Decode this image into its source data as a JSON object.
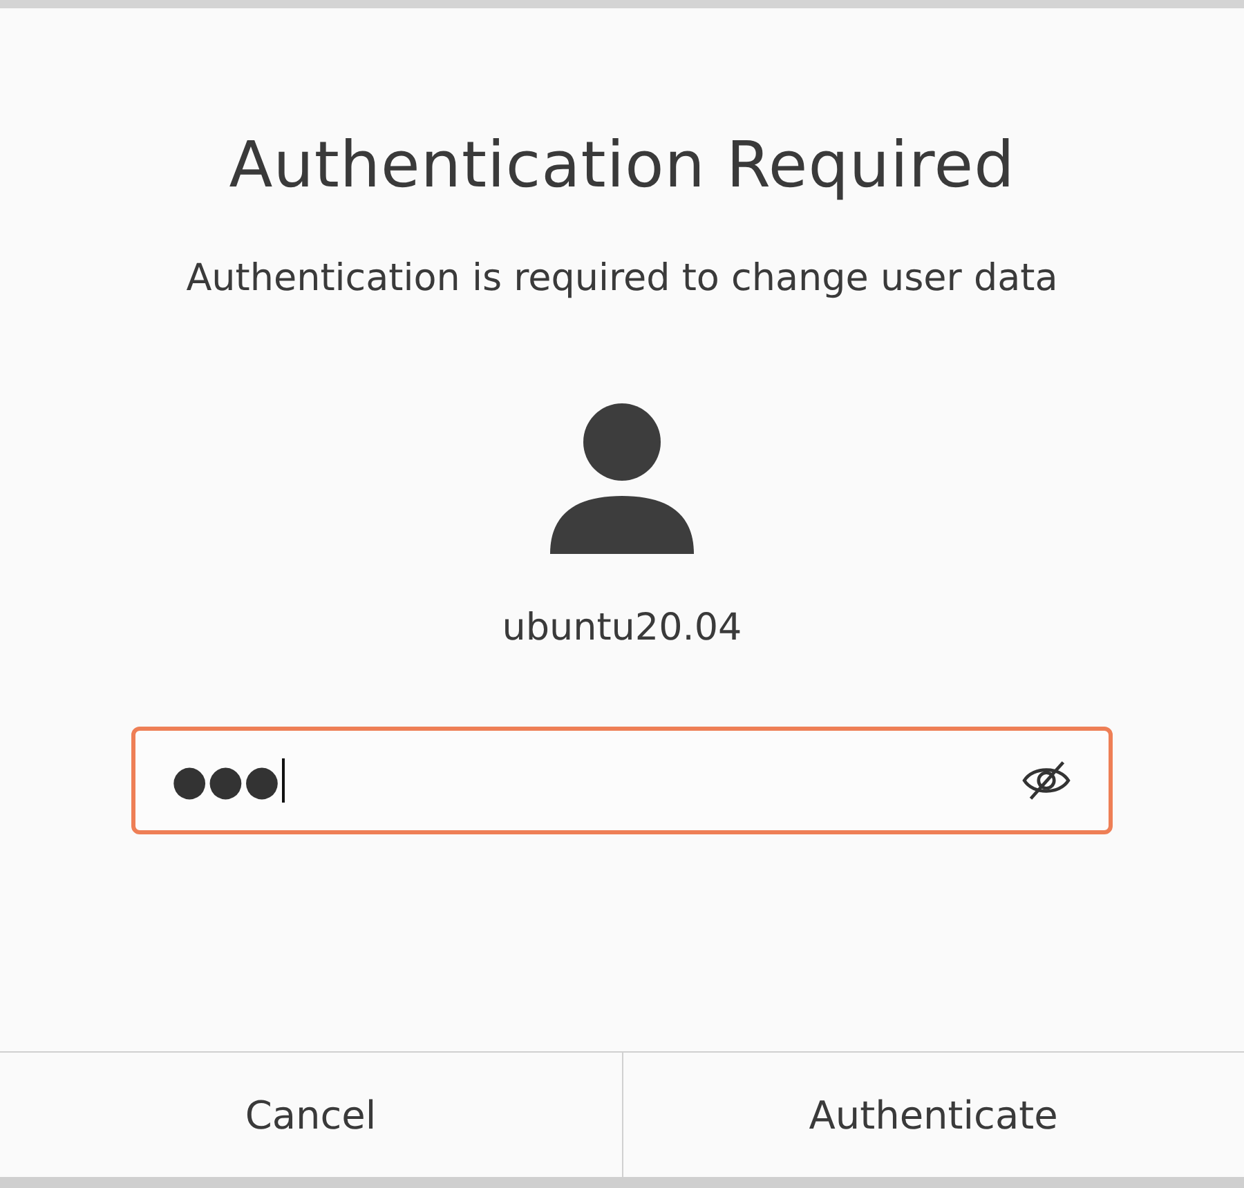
{
  "dialog": {
    "title": "Authentication Required",
    "message": "Authentication is required to change user data"
  },
  "user": {
    "name": "ubuntu20.04"
  },
  "password": {
    "value": "●●●",
    "focused": true
  },
  "buttons": [
    {
      "label": "Cancel"
    },
    {
      "label": "Authenticate"
    }
  ]
}
